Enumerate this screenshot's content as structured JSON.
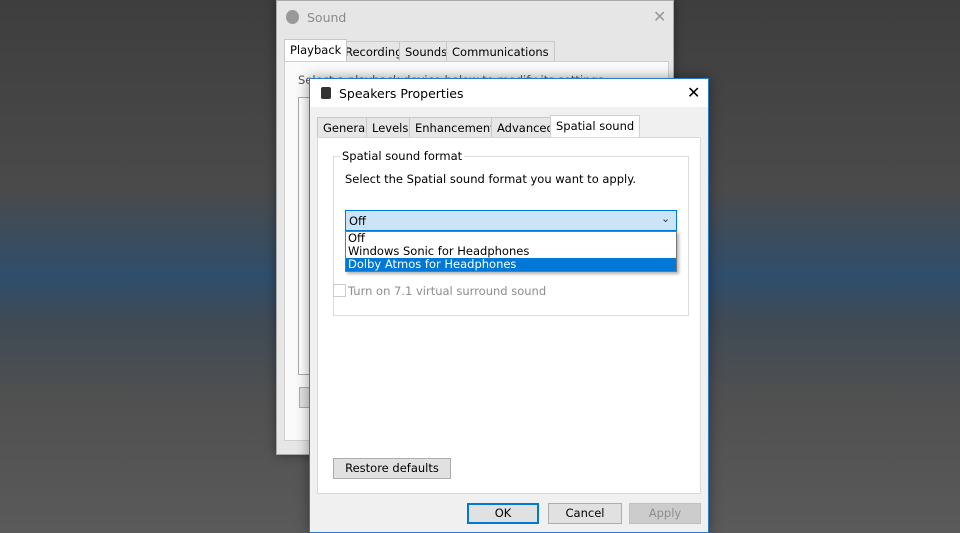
{
  "sound_window": {
    "title": "Sound",
    "tabs": [
      "Playback",
      "Recording",
      "Sounds",
      "Communications"
    ],
    "instruction": "Select a playback device below to modify its settings:"
  },
  "dialog": {
    "title": "Speakers Properties",
    "tabs": [
      "General",
      "Levels",
      "Enhancements",
      "Advanced",
      "Spatial sound"
    ],
    "group_label": "Spatial sound format",
    "instruction": "Select the Spatial sound format you want to apply.",
    "combo_value": "Off",
    "options": [
      "Off",
      "Windows Sonic for Headphones",
      "Dolby Atmos for Headphones"
    ],
    "highlighted_option": "Dolby Atmos for Headphones",
    "checkbox_label": "Turn on 7.1 virtual surround sound",
    "checkbox_checked": false,
    "restore_label": "Restore defaults",
    "ok_label": "OK",
    "cancel_label": "Cancel",
    "apply_label": "Apply"
  },
  "colors": {
    "accent": "#0078d7",
    "combo_bg": "#cce4f7"
  }
}
